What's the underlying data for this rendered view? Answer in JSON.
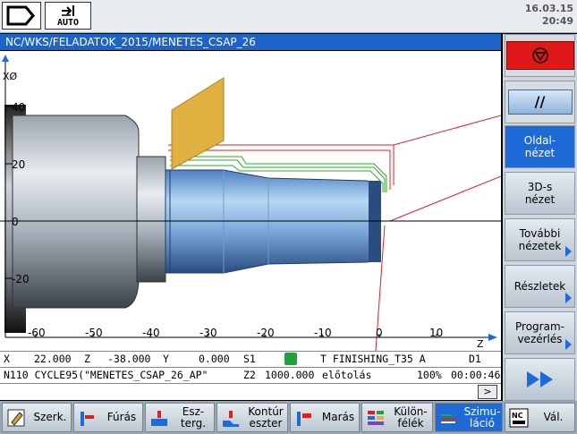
{
  "header": {
    "mode_label": "AUTO",
    "date": "16.03.15",
    "time": "20:49"
  },
  "path": "NC/WKS/FELADATOK_2015/MENETES_CSAP_26",
  "sim": {
    "axis_x_label": "XØ",
    "axis_z_label": "Z",
    "x_ticks": [
      "40",
      "20",
      "0",
      "-20"
    ],
    "z_ticks": [
      "-60",
      "-50",
      "-40",
      "-30",
      "-20",
      "-10",
      "0",
      "10"
    ]
  },
  "status": {
    "row1": {
      "x_label": "X",
      "x_value": "22.000",
      "z_label": "Z",
      "z_value": "-38.000",
      "y_label": "Y",
      "y_value": "0.000",
      "s1_label": "S1",
      "tool": "T FINISHING_T35 A",
      "d_label": "D1"
    },
    "row2": {
      "block": "N110 CYCLE95(\"MENETES_CSAP_26_AP\"",
      "z2_label": "Z2",
      "feed_value": "1000.000",
      "feed_label": "előtolás",
      "override": "100%",
      "elapsed": "00:00:46"
    }
  },
  "vertical_softkeys": [
    {
      "label": "",
      "id": "stop"
    },
    {
      "label": "//",
      "id": "skip"
    },
    {
      "label": "Oldal-\nnézet",
      "id": "side-view"
    },
    {
      "label": "3D-s\nnézet",
      "id": "3d-view"
    },
    {
      "label": "További\nnézetek",
      "id": "more-views"
    },
    {
      "label": "Részletek",
      "id": "details"
    },
    {
      "label": "Program-\nvezérlés",
      "id": "program-control"
    },
    {
      "label": "",
      "id": "fast-forward"
    }
  ],
  "horizontal_softkeys": [
    {
      "label": "Szerk."
    },
    {
      "label": "Fúrás"
    },
    {
      "label": "Esz-\nterg."
    },
    {
      "label": "Kontúr\neszter"
    },
    {
      "label": "Marás"
    },
    {
      "label": "Külön-\nfélék"
    },
    {
      "label": "Szimu-\nláció"
    },
    {
      "label": "Vál."
    }
  ],
  "colors": {
    "accent": "#1e6ad6",
    "tool": "#e0b040",
    "toolpath_red": "#e02020",
    "toolpath_green": "#20b020"
  }
}
